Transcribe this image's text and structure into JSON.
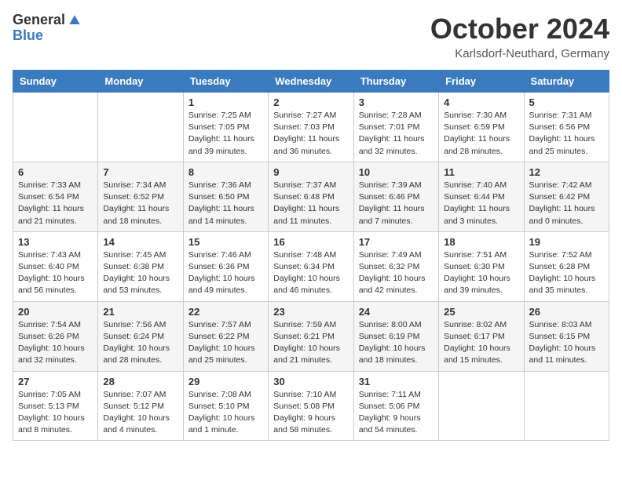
{
  "header": {
    "logo_general": "General",
    "logo_blue": "Blue",
    "month": "October 2024",
    "location": "Karlsdorf-Neuthard, Germany"
  },
  "days_of_week": [
    "Sunday",
    "Monday",
    "Tuesday",
    "Wednesday",
    "Thursday",
    "Friday",
    "Saturday"
  ],
  "weeks": [
    [
      {
        "day": "",
        "detail": ""
      },
      {
        "day": "",
        "detail": ""
      },
      {
        "day": "1",
        "detail": "Sunrise: 7:25 AM\nSunset: 7:05 PM\nDaylight: 11 hours and 39 minutes."
      },
      {
        "day": "2",
        "detail": "Sunrise: 7:27 AM\nSunset: 7:03 PM\nDaylight: 11 hours and 36 minutes."
      },
      {
        "day": "3",
        "detail": "Sunrise: 7:28 AM\nSunset: 7:01 PM\nDaylight: 11 hours and 32 minutes."
      },
      {
        "day": "4",
        "detail": "Sunrise: 7:30 AM\nSunset: 6:59 PM\nDaylight: 11 hours and 28 minutes."
      },
      {
        "day": "5",
        "detail": "Sunrise: 7:31 AM\nSunset: 6:56 PM\nDaylight: 11 hours and 25 minutes."
      }
    ],
    [
      {
        "day": "6",
        "detail": "Sunrise: 7:33 AM\nSunset: 6:54 PM\nDaylight: 11 hours and 21 minutes."
      },
      {
        "day": "7",
        "detail": "Sunrise: 7:34 AM\nSunset: 6:52 PM\nDaylight: 11 hours and 18 minutes."
      },
      {
        "day": "8",
        "detail": "Sunrise: 7:36 AM\nSunset: 6:50 PM\nDaylight: 11 hours and 14 minutes."
      },
      {
        "day": "9",
        "detail": "Sunrise: 7:37 AM\nSunset: 6:48 PM\nDaylight: 11 hours and 11 minutes."
      },
      {
        "day": "10",
        "detail": "Sunrise: 7:39 AM\nSunset: 6:46 PM\nDaylight: 11 hours and 7 minutes."
      },
      {
        "day": "11",
        "detail": "Sunrise: 7:40 AM\nSunset: 6:44 PM\nDaylight: 11 hours and 3 minutes."
      },
      {
        "day": "12",
        "detail": "Sunrise: 7:42 AM\nSunset: 6:42 PM\nDaylight: 11 hours and 0 minutes."
      }
    ],
    [
      {
        "day": "13",
        "detail": "Sunrise: 7:43 AM\nSunset: 6:40 PM\nDaylight: 10 hours and 56 minutes."
      },
      {
        "day": "14",
        "detail": "Sunrise: 7:45 AM\nSunset: 6:38 PM\nDaylight: 10 hours and 53 minutes."
      },
      {
        "day": "15",
        "detail": "Sunrise: 7:46 AM\nSunset: 6:36 PM\nDaylight: 10 hours and 49 minutes."
      },
      {
        "day": "16",
        "detail": "Sunrise: 7:48 AM\nSunset: 6:34 PM\nDaylight: 10 hours and 46 minutes."
      },
      {
        "day": "17",
        "detail": "Sunrise: 7:49 AM\nSunset: 6:32 PM\nDaylight: 10 hours and 42 minutes."
      },
      {
        "day": "18",
        "detail": "Sunrise: 7:51 AM\nSunset: 6:30 PM\nDaylight: 10 hours and 39 minutes."
      },
      {
        "day": "19",
        "detail": "Sunrise: 7:52 AM\nSunset: 6:28 PM\nDaylight: 10 hours and 35 minutes."
      }
    ],
    [
      {
        "day": "20",
        "detail": "Sunrise: 7:54 AM\nSunset: 6:26 PM\nDaylight: 10 hours and 32 minutes."
      },
      {
        "day": "21",
        "detail": "Sunrise: 7:56 AM\nSunset: 6:24 PM\nDaylight: 10 hours and 28 minutes."
      },
      {
        "day": "22",
        "detail": "Sunrise: 7:57 AM\nSunset: 6:22 PM\nDaylight: 10 hours and 25 minutes."
      },
      {
        "day": "23",
        "detail": "Sunrise: 7:59 AM\nSunset: 6:21 PM\nDaylight: 10 hours and 21 minutes."
      },
      {
        "day": "24",
        "detail": "Sunrise: 8:00 AM\nSunset: 6:19 PM\nDaylight: 10 hours and 18 minutes."
      },
      {
        "day": "25",
        "detail": "Sunrise: 8:02 AM\nSunset: 6:17 PM\nDaylight: 10 hours and 15 minutes."
      },
      {
        "day": "26",
        "detail": "Sunrise: 8:03 AM\nSunset: 6:15 PM\nDaylight: 10 hours and 11 minutes."
      }
    ],
    [
      {
        "day": "27",
        "detail": "Sunrise: 7:05 AM\nSunset: 5:13 PM\nDaylight: 10 hours and 8 minutes."
      },
      {
        "day": "28",
        "detail": "Sunrise: 7:07 AM\nSunset: 5:12 PM\nDaylight: 10 hours and 4 minutes."
      },
      {
        "day": "29",
        "detail": "Sunrise: 7:08 AM\nSunset: 5:10 PM\nDaylight: 10 hours and 1 minute."
      },
      {
        "day": "30",
        "detail": "Sunrise: 7:10 AM\nSunset: 5:08 PM\nDaylight: 9 hours and 58 minutes."
      },
      {
        "day": "31",
        "detail": "Sunrise: 7:11 AM\nSunset: 5:06 PM\nDaylight: 9 hours and 54 minutes."
      },
      {
        "day": "",
        "detail": ""
      },
      {
        "day": "",
        "detail": ""
      }
    ]
  ]
}
